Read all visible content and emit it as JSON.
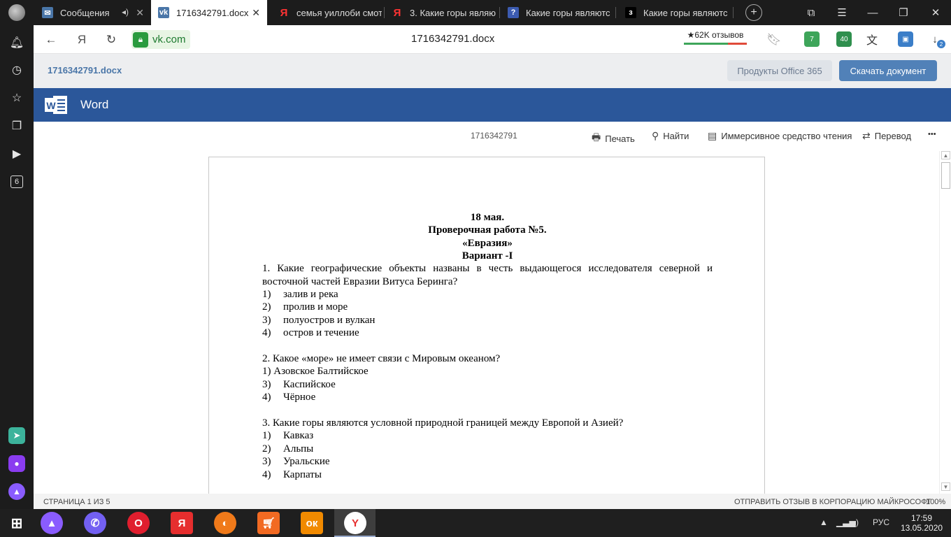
{
  "tabs": [
    {
      "label": "Сообщения",
      "muted": true
    },
    {
      "label": "1716342791.docx",
      "active": true
    },
    {
      "label": "семья уиллоби смот"
    },
    {
      "label": "3. Какие горы являю"
    },
    {
      "label": "Какие горы являютс"
    },
    {
      "label": "Какие горы являютс"
    }
  ],
  "address": {
    "host": "vk.com",
    "page_title": "1716342791.docx",
    "reviews": "★62K отзывов",
    "ext_badges": [
      "7",
      "40",
      "2"
    ]
  },
  "sidebar_badge": "6",
  "vk": {
    "doc_name": "1716342791.docx",
    "office_button": "Продукты Office 365",
    "download_button": "Скачать документ"
  },
  "word": {
    "app_name": "Word",
    "doc_id": "1716342791",
    "print": "Печать",
    "find": "Найти",
    "immersive": "Иммерсивное средство чтения",
    "translate": "Перевод",
    "more": "•••"
  },
  "document": {
    "header": [
      "18 мая.",
      "Проверочная работа №5.",
      "«Евразия»",
      "Вариант -I"
    ],
    "q1_line1": "1. Какие географические объекты названы в честь выдающегося исследователя северной и",
    "q1_line2": "восточной частей Евразии Витуса Беринга?",
    "q1_options": [
      [
        "1)",
        "залив и река"
      ],
      [
        "2)",
        "пролив и море"
      ],
      [
        "3)",
        "полуостров и вулкан"
      ],
      [
        "4)",
        "остров и течение"
      ]
    ],
    "q2": "2. Какое «море» не имеет связи с Мировым океаном?",
    "q2_first": "1)  Азовское Балтийское",
    "q2_options": [
      [
        "3)",
        "Каспийское"
      ],
      [
        "4)",
        "Чёрное"
      ]
    ],
    "q3": "3. Какие горы являются условной природной границей между Европой и Азией?",
    "q3_options": [
      [
        "1)",
        "Кавказ"
      ],
      [
        "2)",
        "Альпы"
      ],
      [
        "3)",
        "Уральские"
      ],
      [
        "4)",
        "Карпаты"
      ]
    ]
  },
  "status": {
    "page_info": "СТРАНИЦА 1 ИЗ 5",
    "feedback": "ОТПРАВИТЬ ОТЗЫВ В КОРПОРАЦИЮ МАЙКРОСОФТ",
    "zoom": "100%"
  },
  "taskbar": {
    "lang": "РУС",
    "time": "17:59",
    "date": "13.05.2020"
  }
}
